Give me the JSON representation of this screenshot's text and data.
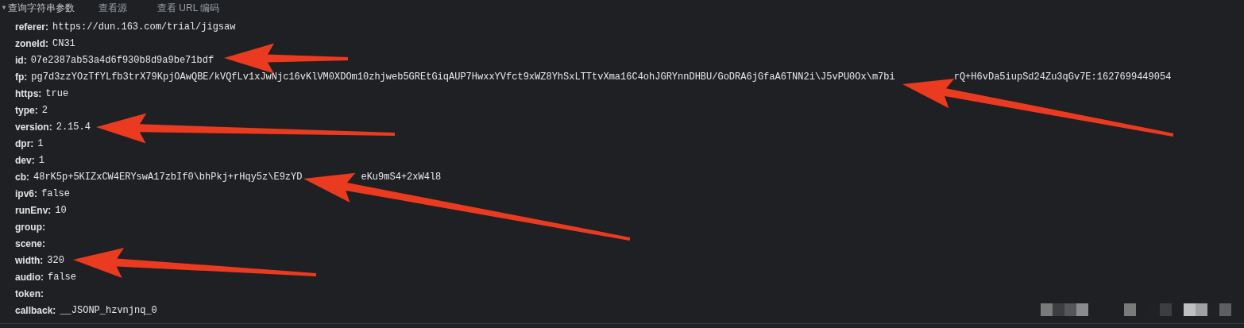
{
  "header": {
    "toggle": "▼",
    "title": "查询字符串参数",
    "actions": [
      "查看源",
      "查看 URL 编码"
    ]
  },
  "params": [
    {
      "name": "referer:",
      "value": "https://dun.163.com/trial/jigsaw"
    },
    {
      "name": "zoneId:",
      "value": "CN31"
    },
    {
      "name": "id:",
      "value": "07e2387ab53a4d6f930b8d9a9be71bdf"
    },
    {
      "name": "fp:",
      "value": "pg7d3zzYOzTfYLfb3trX79KpjOAwQBE/kVQfLv1xJwNjc16vKlVM0XDOm10zhjweb5GREtGiqAUP7HwxxYVfct9xWZ8YhSxLTTtvXma16C4ohJGRYnnDHBU/GoDRA6jGfaA6TNN2i\\J5vPU0Ox\\m7bi",
      "value_after": "rQ+H6vDa5iupSd24Zu3qGv7E:1627699449054"
    },
    {
      "name": "https:",
      "value": "true"
    },
    {
      "name": "type:",
      "value": "2"
    },
    {
      "name": "version:",
      "value": "2.15.4"
    },
    {
      "name": "dpr:",
      "value": "1"
    },
    {
      "name": "dev:",
      "value": "1"
    },
    {
      "name": "cb:",
      "value": "48rK5p+5KIZxCW4ERYswA17zbIf0\\bhPkj+rHqy5z\\E9zYD",
      "value_after": "eKu9mS4+2xW4l8"
    },
    {
      "name": "ipv6:",
      "value": "false"
    },
    {
      "name": "runEnv:",
      "value": "10"
    },
    {
      "name": "group:"
    },
    {
      "name": "scene:"
    },
    {
      "name": "width:",
      "value": "320"
    },
    {
      "name": "audio:",
      "value": "false"
    },
    {
      "name": "token:"
    },
    {
      "name": "callback:",
      "value": "__JSONP_hzvnjnq_0"
    }
  ]
}
